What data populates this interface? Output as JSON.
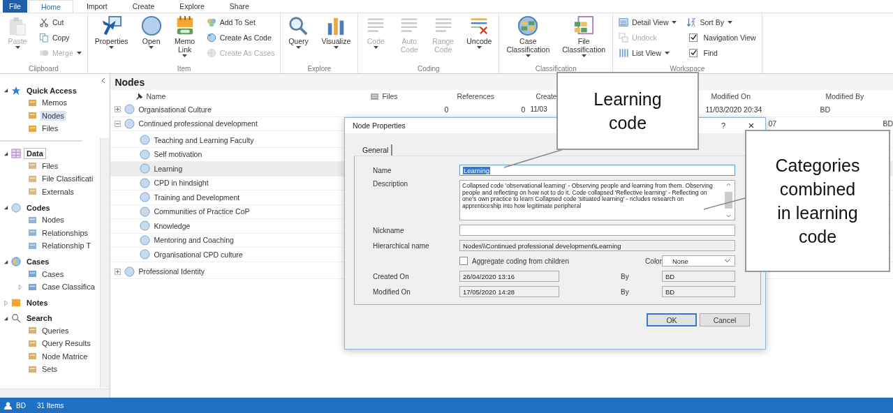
{
  "ribbon": {
    "tabs": [
      {
        "label": "File",
        "kind": "file",
        "selected": false
      },
      {
        "label": "Home",
        "kind": "tab",
        "selected": true
      },
      {
        "label": "Import",
        "kind": "tab",
        "selected": false
      },
      {
        "label": "Create",
        "kind": "tab",
        "selected": false
      },
      {
        "label": "Explore",
        "kind": "tab",
        "selected": false
      },
      {
        "label": "Share",
        "kind": "tab",
        "selected": false
      }
    ],
    "groups": [
      {
        "label": "Clipboard",
        "columns": [
          {
            "kind": "large",
            "label": "Paste",
            "disabled": true,
            "dropdown": true
          },
          {
            "kind": "stack",
            "items": [
              {
                "kind": "button",
                "label": "Cut",
                "disabled": false,
                "dropdown": false
              },
              {
                "kind": "button",
                "label": "Copy",
                "disabled": false,
                "dropdown": false
              },
              {
                "kind": "button",
                "label": "Merge",
                "disabled": true,
                "dropdown": true
              }
            ]
          }
        ]
      },
      {
        "label": "Item",
        "columns": [
          {
            "kind": "large",
            "label": "Properties",
            "disabled": false,
            "dropdown": true
          },
          {
            "kind": "large",
            "label": "Open",
            "disabled": false,
            "dropdown": true
          },
          {
            "kind": "large",
            "label": "Memo Link",
            "disabled": false,
            "dropdown": true
          },
          {
            "kind": "stack",
            "items": [
              {
                "kind": "button",
                "label": "Add To Set",
                "disabled": false,
                "dropdown": false
              },
              {
                "kind": "button",
                "label": "Create As Code",
                "disabled": false,
                "dropdown": false
              },
              {
                "kind": "button",
                "label": "Create As Cases",
                "disabled": true,
                "dropdown": false
              }
            ]
          }
        ]
      },
      {
        "label": "Explore",
        "columns": [
          {
            "kind": "large",
            "label": "Query",
            "disabled": false,
            "dropdown": true
          },
          {
            "kind": "large",
            "label": "Visualize",
            "disabled": false,
            "dropdown": true
          }
        ]
      },
      {
        "label": "Coding",
        "columns": [
          {
            "kind": "large",
            "label": "Code",
            "disabled": true,
            "dropdown": true
          },
          {
            "kind": "large",
            "label": "Auto Code",
            "disabled": true,
            "dropdown": false
          },
          {
            "kind": "large",
            "label": "Range Code",
            "disabled": true,
            "dropdown": false
          },
          {
            "kind": "large",
            "label": "Uncode",
            "disabled": false,
            "dropdown": true
          }
        ]
      },
      {
        "label": "Classification",
        "columns": [
          {
            "kind": "large",
            "label": "Case Classification",
            "disabled": false,
            "dropdown": true
          },
          {
            "kind": "large",
            "label": "File Classification",
            "disabled": false,
            "dropdown": true
          }
        ]
      },
      {
        "label": "Workspace",
        "columns": [
          {
            "kind": "stack",
            "items": [
              {
                "kind": "button",
                "label": "Detail View",
                "disabled": false,
                "dropdown": true
              },
              {
                "kind": "button",
                "label": "Undock",
                "disabled": true,
                "dropdown": false
              },
              {
                "kind": "button",
                "label": "List View",
                "disabled": false,
                "dropdown": true
              }
            ]
          },
          {
            "kind": "stack",
            "items": [
              {
                "kind": "button",
                "label": "Sort By",
                "disabled": false,
                "dropdown": true
              },
              {
                "kind": "check",
                "label": "Navigation View",
                "checked": true
              },
              {
                "kind": "check",
                "label": "Find",
                "checked": true
              }
            ]
          }
        ]
      }
    ]
  },
  "navigation": {
    "sections": [
      {
        "label": "Quick Access",
        "expanded": true,
        "selected": false,
        "items": [
          {
            "label": "Memos",
            "selected": false
          },
          {
            "label": "Nodes",
            "selected": true
          },
          {
            "label": "Files",
            "selected": false
          }
        ]
      },
      {
        "label": "Data",
        "expanded": true,
        "selected": true,
        "items": [
          {
            "label": "Files",
            "selected": false
          },
          {
            "label": "File Classificati",
            "selected": false
          },
          {
            "label": "Externals",
            "selected": false
          }
        ]
      },
      {
        "label": "Codes",
        "expanded": true,
        "selected": false,
        "items": [
          {
            "label": "Nodes",
            "selected": false
          },
          {
            "label": "Relationships",
            "selected": false
          },
          {
            "label": "Relationship T",
            "selected": false
          }
        ]
      },
      {
        "label": "Cases",
        "expanded": true,
        "selected": false,
        "items": [
          {
            "label": "Cases",
            "selected": false
          },
          {
            "label": "Case Classifica",
            "selected": false,
            "expandable": true
          }
        ]
      },
      {
        "label": "Notes",
        "expanded": false,
        "selected": false
      },
      {
        "label": "Search",
        "expanded": true,
        "selected": false,
        "items": [
          {
            "label": "Queries",
            "selected": false
          },
          {
            "label": "Query Results",
            "selected": false
          },
          {
            "label": "Node Matrice",
            "selected": false
          },
          {
            "label": "Sets",
            "selected": false
          }
        ]
      }
    ]
  },
  "nodes": {
    "title": "Nodes",
    "columns": [
      "Name",
      "Files",
      "References",
      "Create",
      "Modified On",
      "Modified By"
    ],
    "rows": [
      {
        "name": "Organisational Culture",
        "expanded": false,
        "selected": false,
        "files": "0",
        "references": "0",
        "created": "11/03",
        "modified_on": {
          "text": "11/03/2020 20:34",
          "kind": "full"
        },
        "modified_by": "BD"
      },
      {
        "name": "Continued professional development",
        "expanded": true,
        "selected": false,
        "modified_on": {
          "text": "07",
          "kind": "tail"
        },
        "modified_by": "BD",
        "children": [
          {
            "name": "Teaching and Learning Faculty",
            "selected": false
          },
          {
            "name": "Self motivation",
            "selected": false
          },
          {
            "name": "Learning",
            "selected": true
          },
          {
            "name": "CPD in hindsight",
            "selected": false
          },
          {
            "name": "Training and Development",
            "selected": false
          },
          {
            "name": "Communities of Practice CoP",
            "selected": false
          },
          {
            "name": "Knowledge",
            "selected": false
          },
          {
            "name": "Mentoring and Coaching",
            "selected": false
          },
          {
            "name": "Organisational CPD culture",
            "selected": false
          }
        ]
      },
      {
        "name": "Professional Identity",
        "expanded": false,
        "selected": false
      }
    ]
  },
  "dialog": {
    "title": "Node Properties",
    "help": "?",
    "close": "×",
    "tabs": [
      {
        "label": "General",
        "selected": true
      }
    ],
    "name_label": "Name",
    "name_value": "Learning",
    "name_selected": true,
    "description_label": "Description",
    "description": "Collapsed code 'observational learning' - Observing people and learning from them. Observing people and reflecting on how not to do it.  Code collapsed 'Reflective learning' - Reflecting on one's own practice to learn  Collapsed code 'situated learning' - ncludes research on apprenticeship into how legitimate peripheral",
    "nickname_label": "Nickname",
    "hierarchical_label": "Hierarchical name",
    "hierarchical_value": "Nodes\\\\Continued professional development\\Learning",
    "aggregate": {
      "label": "Aggregate coding from children",
      "checked": false
    },
    "color_label": "Color",
    "color_value": "None",
    "created_label": "Created On",
    "created_value": "26/04/2020 13:16",
    "created_by_label": "By",
    "created_by": "BD",
    "modified_label": "Modified On",
    "modified_value": "17/05/2020 14:28",
    "modified_by_label": "By",
    "modified_by": "BD",
    "buttons": [
      {
        "label": "OK",
        "kind": "default"
      },
      {
        "label": "Cancel",
        "kind": "normal"
      }
    ]
  },
  "annotations": [
    {
      "text": "Learning code"
    },
    {
      "text": "Categories combined in learning code"
    }
  ],
  "status_bar": {
    "user": "BD",
    "items": "31 Items"
  }
}
